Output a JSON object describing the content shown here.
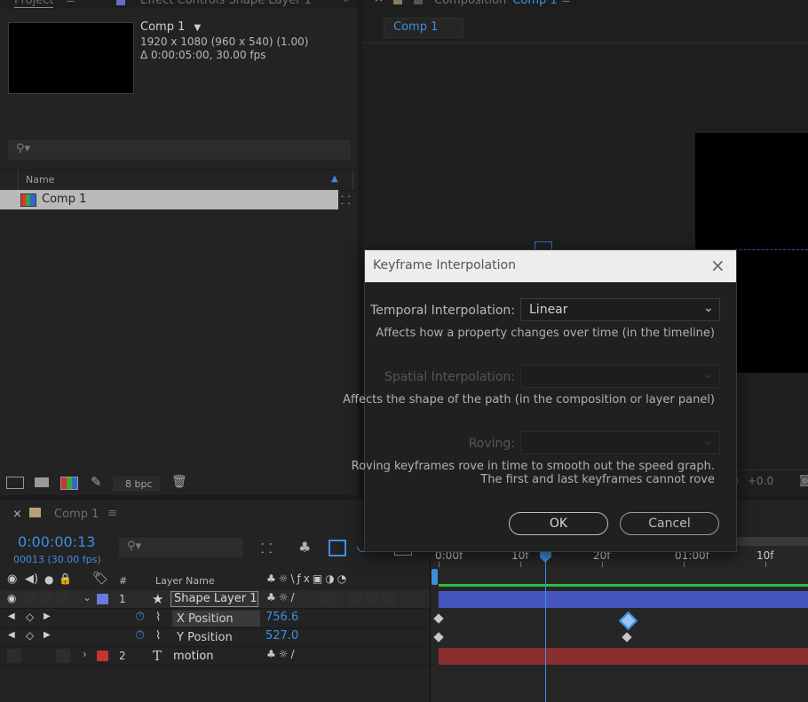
{
  "colors": {
    "accent": "#3d8fe0",
    "layer1_label": "#6a78e0",
    "layer2_label": "#c43434",
    "layer1_bar": "#4656bf",
    "layer2_bar": "#8a2f2f",
    "work_area": "#2fbf3f"
  },
  "project_panel": {
    "tab_project": "Project",
    "tab_effect_controls": "Effect Controls Shape Layer 1",
    "comp_name": "Comp 1",
    "comp_resolution": "1920 x 1080  (960 x 540) (1.00)",
    "comp_duration": "Δ 0:00:05:00, 30.00 fps",
    "column_name": "Name",
    "items": [
      {
        "name": "Comp 1",
        "icon": "composition-icon"
      }
    ],
    "bpc": "8 bpc"
  },
  "composition_panel": {
    "tab_prefix": "Composition",
    "tab_comp": "Comp 1",
    "sub_tab": "Comp 1",
    "exposure": "+0.0"
  },
  "timeline": {
    "tab_label": "Comp 1",
    "timecode": "0:00:00:13",
    "frame_info": "00013 (30.00 fps)",
    "columns": {
      "number": "#",
      "layer_name": "Layer Name"
    },
    "ruler_ticks": [
      "0:00f",
      "10f",
      "20f",
      "01:00f",
      "10f"
    ],
    "layers": [
      {
        "index": "1",
        "name": "Shape Layer 1",
        "type": "shape-star-icon"
      },
      {
        "index": "2",
        "name": "motion",
        "type": "text-layer-icon"
      }
    ],
    "properties": [
      {
        "name": "X Position",
        "value": "756.6"
      },
      {
        "name": "Y Position",
        "value": "527.0"
      }
    ],
    "current_frame": 13,
    "keyframes": [
      {
        "property": "X Position",
        "frames": [
          0,
          23
        ],
        "selected_frame": 23
      },
      {
        "property": "Y Position",
        "frames": [
          0,
          23
        ]
      }
    ]
  },
  "dialog": {
    "title": "Keyframe Interpolation",
    "temporal_label": "Temporal Interpolation:",
    "temporal_value": "Linear",
    "temporal_desc": "Affects how a property changes over time (in the timeline)",
    "spatial_label": "Spatial Interpolation:",
    "spatial_desc": "Affects the shape of the path (in the composition or layer panel)",
    "roving_label": "Roving:",
    "roving_desc_1": "Roving keyframes rove in time to smooth out the speed graph.",
    "roving_desc_2": "The first and last keyframes cannot rove",
    "ok": "OK",
    "cancel": "Cancel"
  }
}
